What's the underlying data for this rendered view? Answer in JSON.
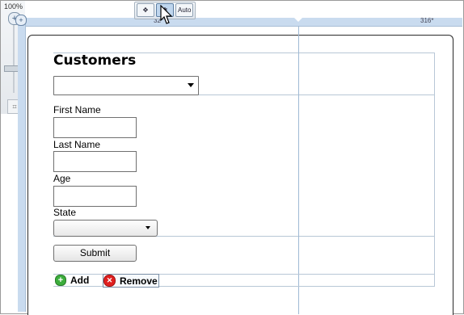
{
  "zoom": {
    "percent": "100%"
  },
  "toolbar": {
    "buttons": [
      {
        "icon": "move-icon",
        "glyph": "✥"
      },
      {
        "icon": "pan-icon",
        "glyph": "✱"
      },
      {
        "label": "Auto"
      }
    ]
  },
  "rulers": {
    "top_left_label": "32*",
    "top_right_label": "316*"
  },
  "form": {
    "title": "Customers",
    "fields": {
      "first_name_label": "First Name",
      "last_name_label": "Last Name",
      "age_label": "Age",
      "state_label": "State"
    },
    "submit_label": "Submit",
    "actions": {
      "add_label": "Add",
      "remove_label": "Remove"
    }
  },
  "colors": {
    "ruler": "#c9dbef",
    "guide": "#9fb9d4",
    "add_green": "#3cae3c",
    "remove_red": "#e02020"
  }
}
